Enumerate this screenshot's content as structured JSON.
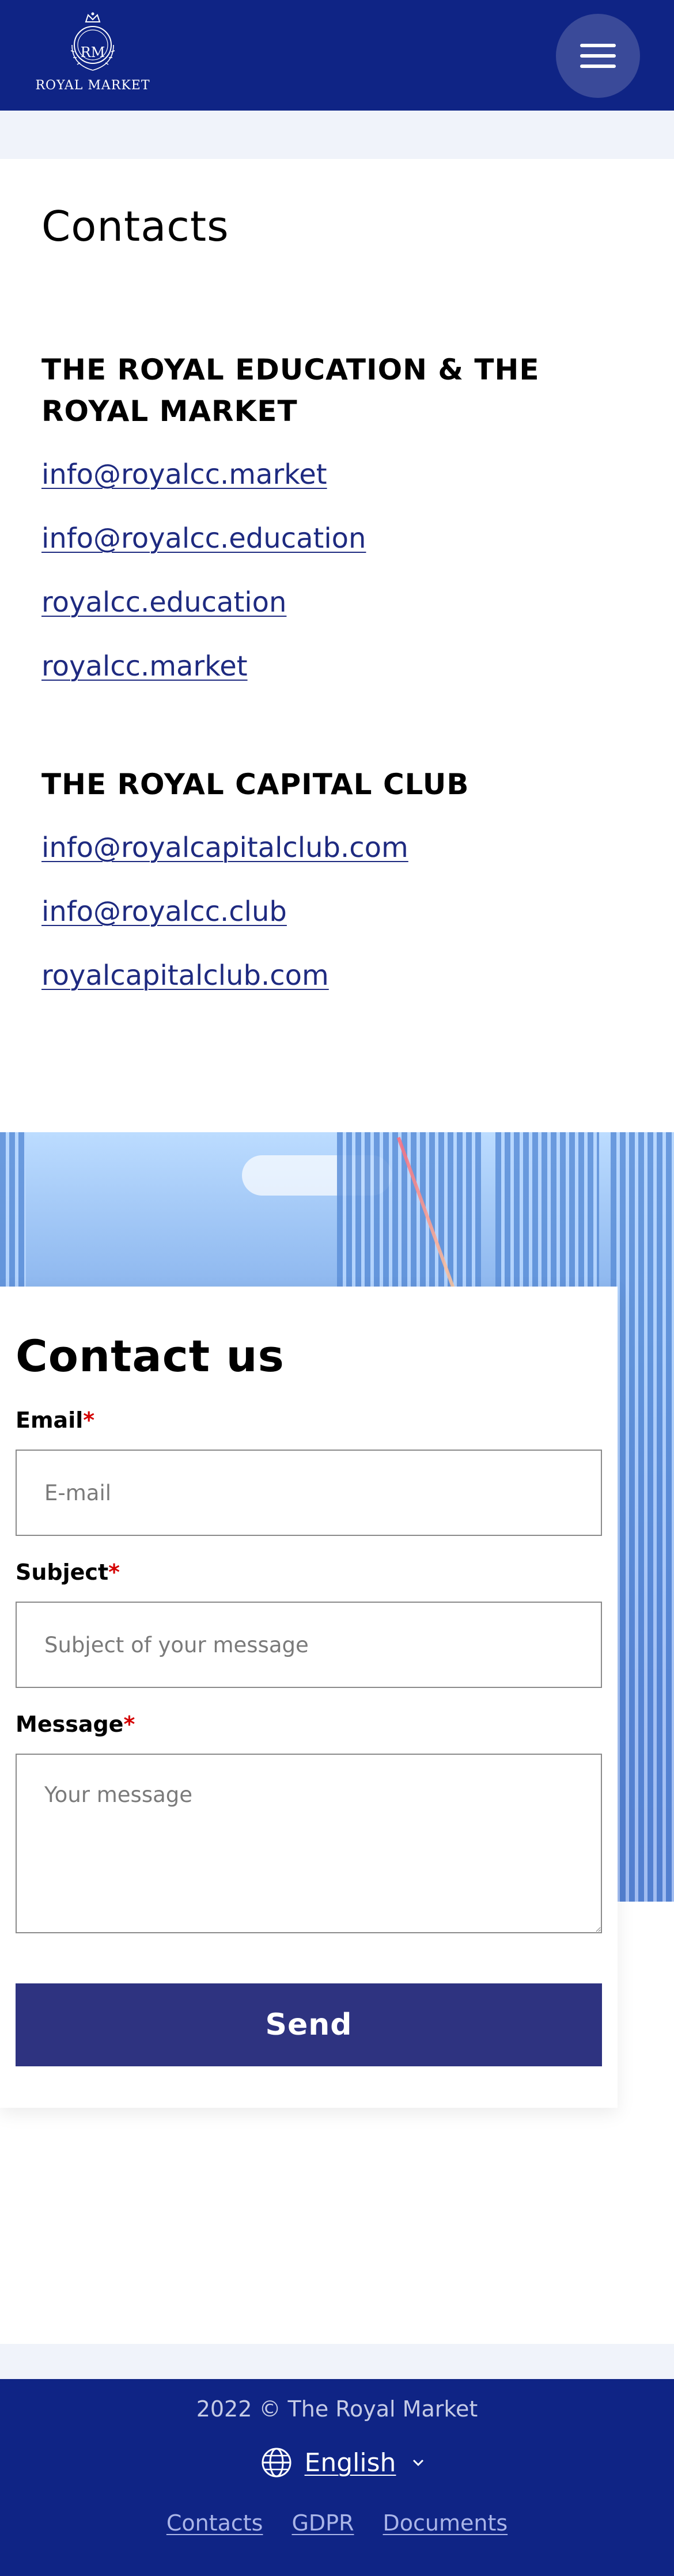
{
  "header": {
    "logo_text": "ROYAL MARKET",
    "logo_monogram": "RM",
    "menu_icon": "hamburger-icon"
  },
  "contacts": {
    "title": "Contacts",
    "groups": [
      {
        "title": "THE ROYAL EDUCATION & THE ROYAL MARKET",
        "links": [
          "info@royalcc.market",
          "info@royalcc.education",
          "royalcc.education",
          "royalcc.market"
        ]
      },
      {
        "title": "THE ROYAL CAPITAL CLUB",
        "links": [
          "info@royalcapitalclub.com",
          "info@royalcc.club",
          "royalcapitalclub.com"
        ]
      }
    ]
  },
  "form": {
    "title": "Contact us",
    "required_mark": "*",
    "email": {
      "label": "Email",
      "placeholder": "E-mail"
    },
    "subject": {
      "label": "Subject",
      "placeholder": "Subject of your message"
    },
    "message": {
      "label": "Message",
      "placeholder": "Your message"
    },
    "submit_label": "Send"
  },
  "footer": {
    "copyright": "2022 © The Royal Market",
    "language": "English",
    "links": [
      "Contacts",
      "GDPR",
      "Documents"
    ]
  },
  "colors": {
    "header_bg": "#0f2485",
    "link": "#1e2a80",
    "button": "#2e3380",
    "required": "#d40000"
  }
}
